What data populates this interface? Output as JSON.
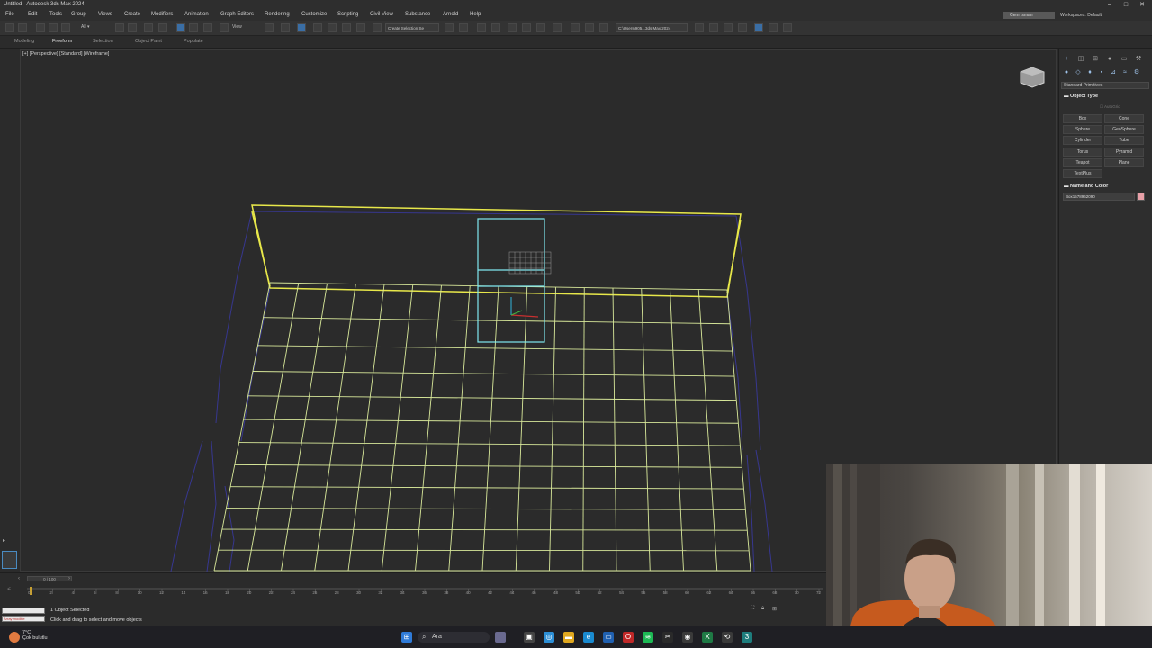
{
  "window": {
    "title": "Untitled - Autodesk 3ds Max 2024"
  },
  "menubar": {
    "items": [
      "File",
      "Edit",
      "Tools",
      "Group",
      "Views",
      "Create",
      "Modifiers",
      "Animation",
      "Graph Editors",
      "Rendering",
      "Customize",
      "Scripting",
      "Civil View",
      "Substance",
      "Arnold",
      "Help"
    ]
  },
  "account": {
    "user": "Cem Isman",
    "workspaces_label": "Workspaces:",
    "workspace": "Default"
  },
  "toolbar": {
    "view_dropdown": "View",
    "selection_set": "Create Selection Se",
    "project_path": "C:\\Users\\905...3ds Max 2024"
  },
  "ribbon": {
    "tabs": [
      "Modeling",
      "Freeform",
      "Selection",
      "Object Paint",
      "Populate"
    ]
  },
  "viewport": {
    "label": "[+] [Perspective] [Standard] [Wireframe]"
  },
  "command_panel": {
    "category_dropdown": "Standard Primitives",
    "object_type_header": "Object Type",
    "autogrid_label": "AutoGrid",
    "primitives": [
      "Box",
      "Cone",
      "Sphere",
      "GeoSphere",
      "Cylinder",
      "Tube",
      "Torus",
      "Pyramid",
      "Teapot",
      "Plane",
      "TextPlus"
    ],
    "name_color_header": "Name and Color",
    "object_name": "Box1578962090",
    "object_color": "#e8a0a8"
  },
  "timeline": {
    "slider": "0 / 100",
    "ticks": [
      "0",
      "2",
      "4",
      "6",
      "8",
      "10",
      "12",
      "14",
      "16",
      "18",
      "20",
      "22",
      "24",
      "26",
      "28",
      "30",
      "32",
      "34",
      "36",
      "38",
      "40",
      "42",
      "44",
      "46",
      "48",
      "50",
      "52",
      "54",
      "56",
      "58",
      "60",
      "62",
      "64",
      "66",
      "68",
      "70",
      "72"
    ]
  },
  "status": {
    "maxscript_text": "Array modifie",
    "selected_count": "1 Object Selected",
    "prompt": "Click and drag to select and move objects"
  },
  "taskbar": {
    "search_label": "Ara",
    "weather_temp": "7°C",
    "weather_desc": "Çok bulutlu"
  },
  "colors": {
    "selection_yellow": "#e8e84a",
    "floor_grid": "#d8e89a",
    "box_cyan": "#7fe8f0",
    "wire_blue": "#3a3aa8",
    "accent": "#3a6ea5"
  }
}
